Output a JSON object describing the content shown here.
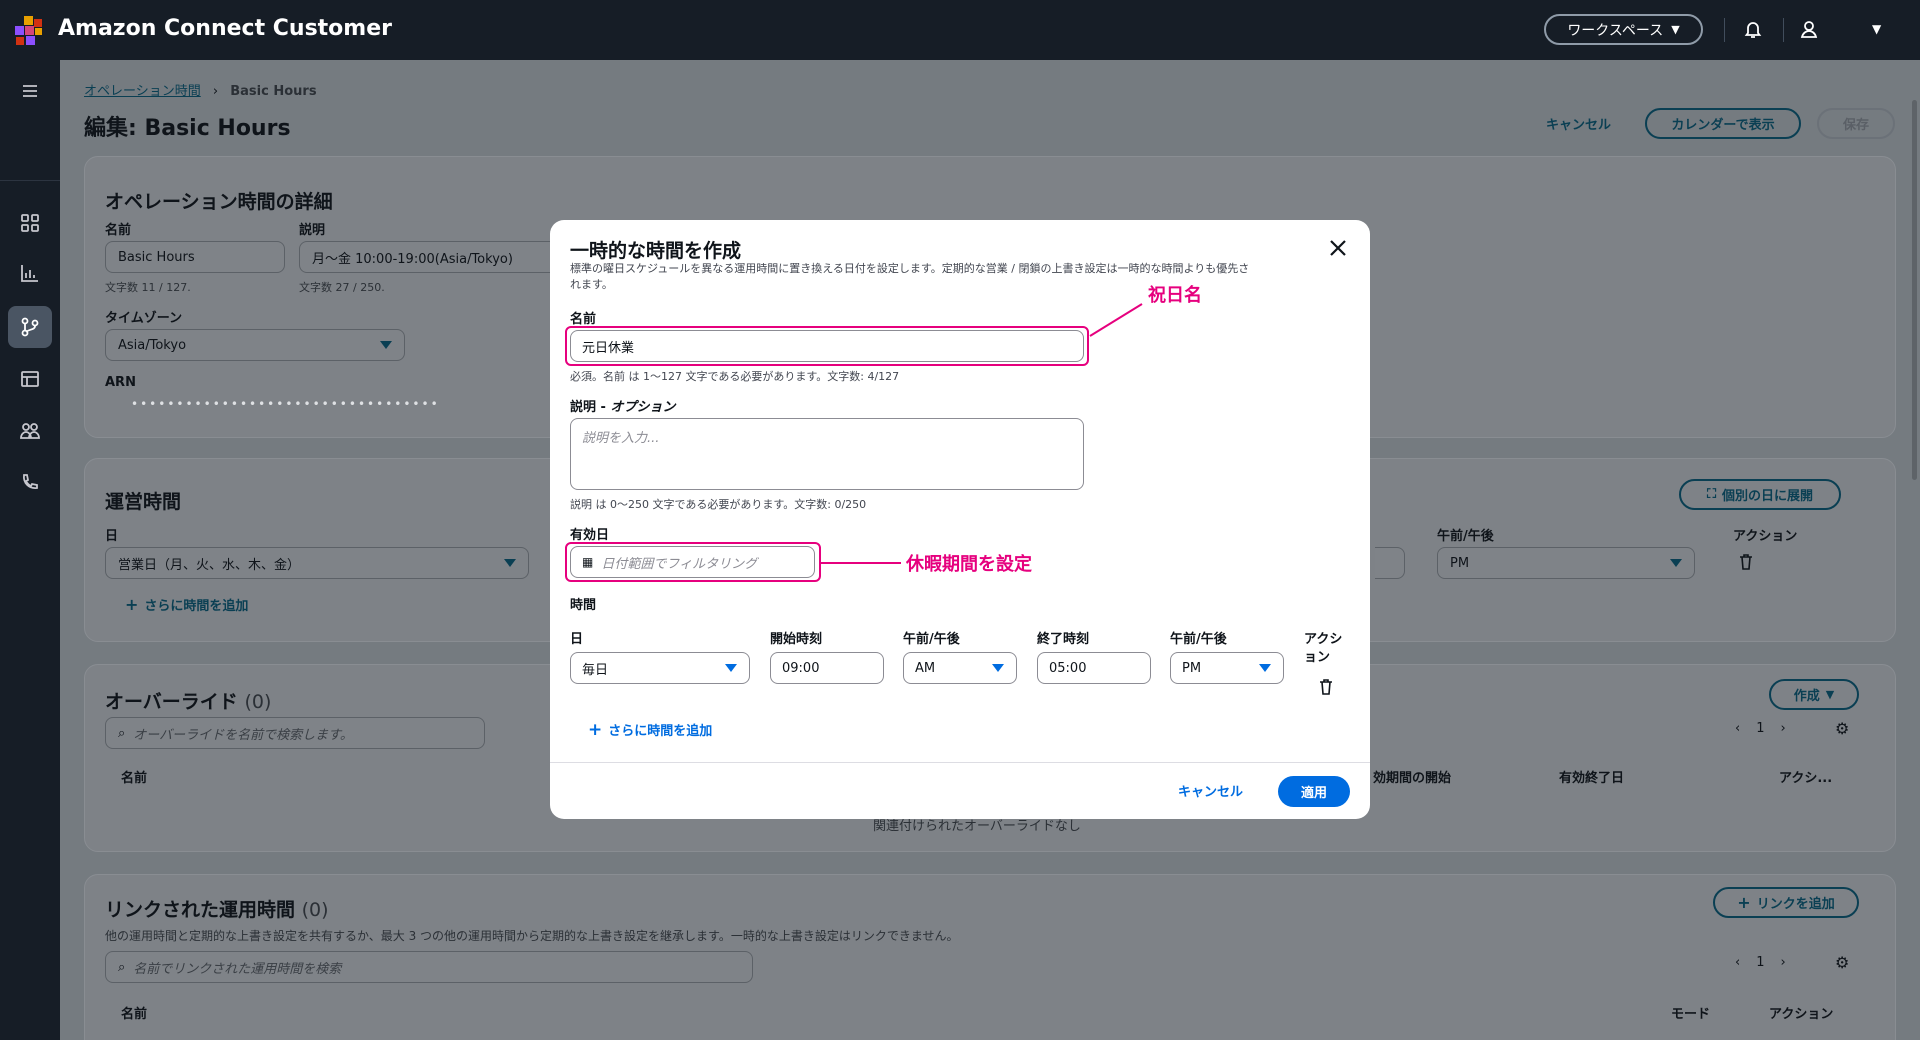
{
  "app": {
    "title": "Amazon Connect Customer"
  },
  "topbar": {
    "workspace_label": "ワークスペース"
  },
  "breadcrumb": {
    "parent": "オペレーション時間",
    "current": "Basic Hours"
  },
  "page": {
    "title": "編集: Basic Hours",
    "cancel_label": "キャンセル",
    "calendar_label": "カレンダーで表示",
    "save_label": "保存"
  },
  "details": {
    "heading": "オペレーション時間の詳細",
    "name_label": "名前",
    "name_value": "Basic Hours",
    "name_hint": "文字数 11 / 127.",
    "desc_label": "説明",
    "desc_value": "月〜金 10:00-19:00(Asia/Tokyo)",
    "desc_hint": "文字数 27 / 250.",
    "tz_label": "タイムゾーン",
    "tz_value": "Asia/Tokyo",
    "arn_label": "ARN",
    "arn_value": "••••••••••••••••••••••••••••••••••"
  },
  "hours": {
    "heading": "運営時間",
    "expand_label": "個別の日に展開",
    "day_label": "日",
    "day_value": "営業日（月、火、水、木、金）",
    "ampm_label": "午前/午後",
    "ampm_value": "PM",
    "action_label": "アクション",
    "add_label": "さらに時間を追加"
  },
  "overrides": {
    "heading": "オーバーライド",
    "count": "(0)",
    "create_label": "作成",
    "search_placeholder": "オーバーライドを名前で検索します。",
    "page": "1",
    "columns": [
      "名前",
      "効期間の開始",
      "有効終了日",
      "アクシ..."
    ],
    "empty": "関連付けられたオーバーライドなし"
  },
  "linked": {
    "heading": "リンクされた運用時間",
    "count": "(0)",
    "add_label": "リンクを追加",
    "description": "他の運用時間と定期的な上書き設定を共有するか、最大 3 つの他の運用時間から定期的な上書き設定を継承します。一時的な上書き設定はリンクできません。",
    "search_placeholder": "名前でリンクされた運用時間を検索",
    "page": "1",
    "columns": [
      "名前",
      "モード",
      "アクション"
    ]
  },
  "modal": {
    "title": "一時的な時間を作成",
    "description_line1": "標準の曜日スケジュールを異なる運用時間に置き換える日付を設定します。定期的な営業 / 閉鎖の上書き設定は一時的な時間よりも優先さ",
    "description_line2": "れます。",
    "name_label": "名前",
    "name_value": "元日休業",
    "name_hint": "必須。名前 は 1〜127 文字である必要があります。文字数: 4/127",
    "desc_label": "説明 - ",
    "desc_label_optional": "オプション",
    "desc_placeholder": "説明を入力...",
    "desc_hint": "説明 は 0〜250 文字である必要があります。文字数: 0/250",
    "valid_label": "有効日",
    "valid_placeholder": "日付範囲でフィルタリング",
    "time_label": "時間",
    "day_col": "日",
    "start_col": "開始時刻",
    "ampm_col": "午前/午後",
    "end_col": "終了時刻",
    "ampm_col2": "午前/午後",
    "action_col_line1": "アクシ",
    "action_col_line2": "ョン",
    "day_value": "毎日",
    "start_value": "09:00",
    "start_ampm": "AM",
    "end_value": "05:00",
    "end_ampm": "PM",
    "add_label": "さらに時間を追加",
    "cancel_label": "キャンセル",
    "apply_label": "適用"
  },
  "annotations": {
    "holiday_name": "祝日名",
    "vacation_period": "休暇期間を設定"
  },
  "colors": {
    "accent": "#0a5a7a",
    "highlight": "#e6007e",
    "topbar": "#161d26"
  }
}
